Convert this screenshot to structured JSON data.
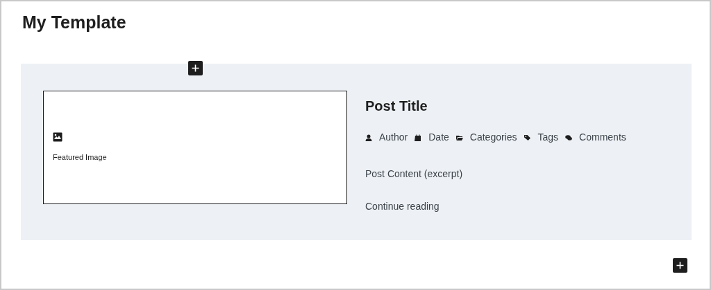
{
  "title": "My Template",
  "featured_image": {
    "label": "Featured Image"
  },
  "post": {
    "title": "Post Title",
    "meta": [
      {
        "kind": "author",
        "label": "Author"
      },
      {
        "kind": "date",
        "label": "Date"
      },
      {
        "kind": "categories",
        "label": "Categories"
      },
      {
        "kind": "tags",
        "label": "Tags"
      },
      {
        "kind": "comments",
        "label": "Comments"
      }
    ],
    "excerpt": "Post Content (excerpt)",
    "read_more": "Continue reading"
  }
}
